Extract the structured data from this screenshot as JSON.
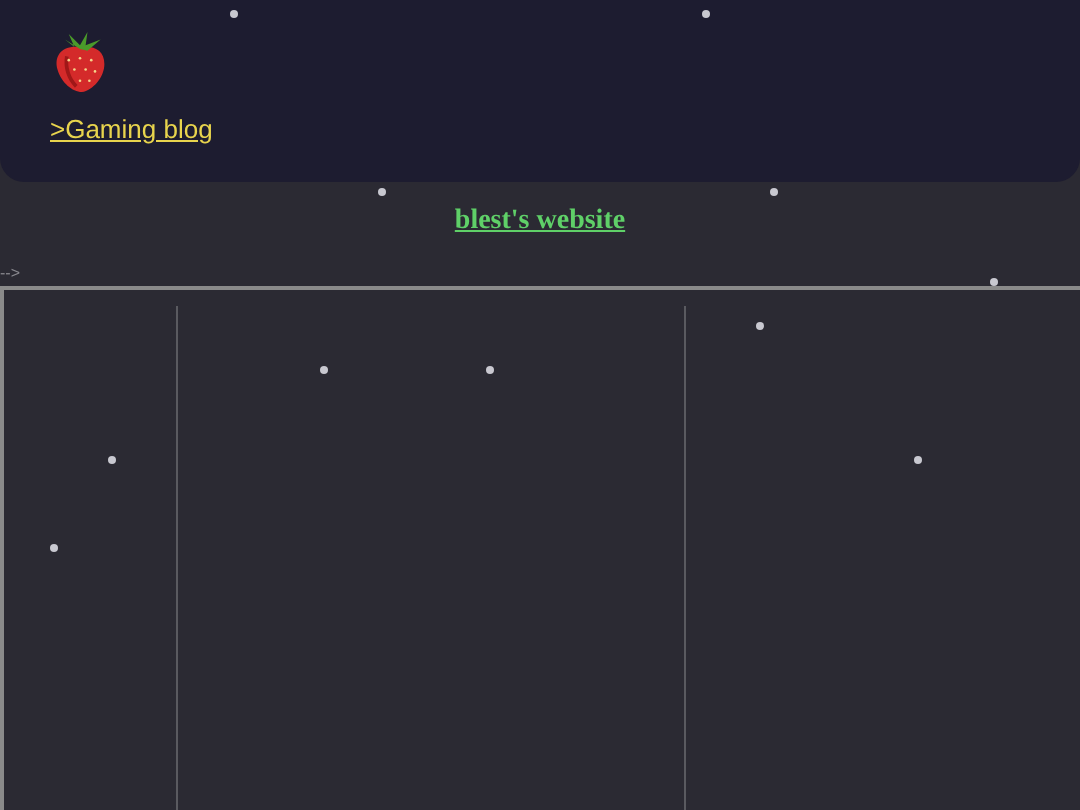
{
  "header": {
    "link": ">Gaming blog"
  },
  "title": "blest's website",
  "comment_text": "-->"
}
